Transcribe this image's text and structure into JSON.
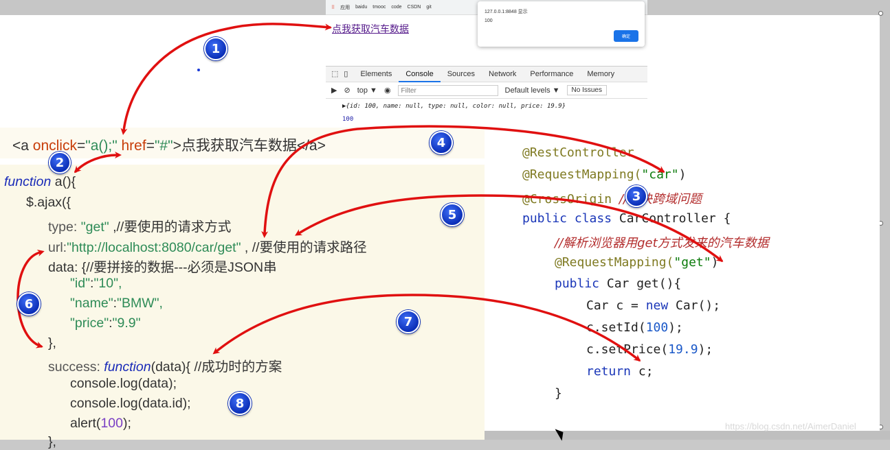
{
  "browser": {
    "bookmarks": [
      "应用",
      "baidu",
      "tmooc",
      "code",
      "CSDN",
      "git"
    ],
    "page_link": "点我获取汽车数据",
    "alert": {
      "title": "127.0.0.1:8848 显示",
      "message": "100",
      "ok_label": "确定"
    },
    "devtools": {
      "tabs": [
        "Elements",
        "Console",
        "Sources",
        "Network",
        "Performance",
        "Memory"
      ],
      "active_tab": "Console",
      "context": "top ▼",
      "filter_placeholder": "Filter",
      "levels": "Default levels ▼",
      "issues": "No Issues",
      "log_object": "▶{id: 100, name: null, type: null, color: null, price: 19.9}",
      "log_value": "100"
    }
  },
  "html_line": {
    "open": "<a ",
    "attr1": "onclick",
    "eq1": "=",
    "val1": "\"a();\"",
    "attr2": " href",
    "eq2": "=",
    "val2": "\"#\"",
    "text": ">点我获取汽车数据</a>"
  },
  "js": {
    "l1_kw": "function",
    "l1_rest": " a(){",
    "l2": "$.ajax({",
    "l3_key": "type: ",
    "l3_val": "\"get\"",
    "l3_cm": " ,//要使用的请求方式",
    "l4_key": "url:",
    "l4_val": "\"http://localhost:8080/car/get\"",
    "l4_cm": " , //要使用的请求路径",
    "l5": "data: {//要拼接的数据---必须是JSON串",
    "l6_k": "\"id\"",
    "l6_v": "\"10\",",
    "l7_k": "\"name\"",
    "l7_v": "\"BMW\",",
    "l8_k": "\"price\"",
    "l8_v": "\"9.9\"",
    "l9": "},",
    "l10_key": "success: ",
    "l10_kw": "function",
    "l10_rest": "(data){ //成功时的方案",
    "l11": "console.log(data);",
    "l12": "console.log(data.id);",
    "l13_a": "alert(",
    "l13_n": "100",
    "l13_b": ");",
    "l14": "},"
  },
  "java": {
    "a1": "@RestController",
    "a2_ann": "@RequestMapping(",
    "a2_str": "\"car\"",
    "a2_end": ")",
    "a3_ann": "@CrossOrigin ",
    "a3_cm": "//解决跨域问题",
    "c1_kw": "public class",
    "c1_rest": " CarController {",
    "cm2": "//解析浏览器用get方式发来的汽车数据",
    "m_ann": "@RequestMapping(",
    "m_str": "\"get\"",
    "m_end": ")",
    "m1_kw": "public",
    "m1_rest": " Car get(){",
    "b1_a": "Car c = ",
    "b1_kw": "new",
    "b1_b": " Car();",
    "b2_a": "c.setId(",
    "b2_n": "100",
    "b2_b": ");",
    "b3_a": "c.setPrice(",
    "b3_n": "19.9",
    "b3_b": ");",
    "b4_kw": "return",
    "b4_rest": " c;",
    "close": "}"
  },
  "badges": [
    "1",
    "2",
    "3",
    "4",
    "5",
    "6",
    "7",
    "8"
  ],
  "watermark": "https://blog.csdn.net/AimerDaniel",
  "colors": {
    "arrow": "#e01010",
    "badge": "#0b2fb8",
    "code_bg": "#fbf8e8"
  }
}
